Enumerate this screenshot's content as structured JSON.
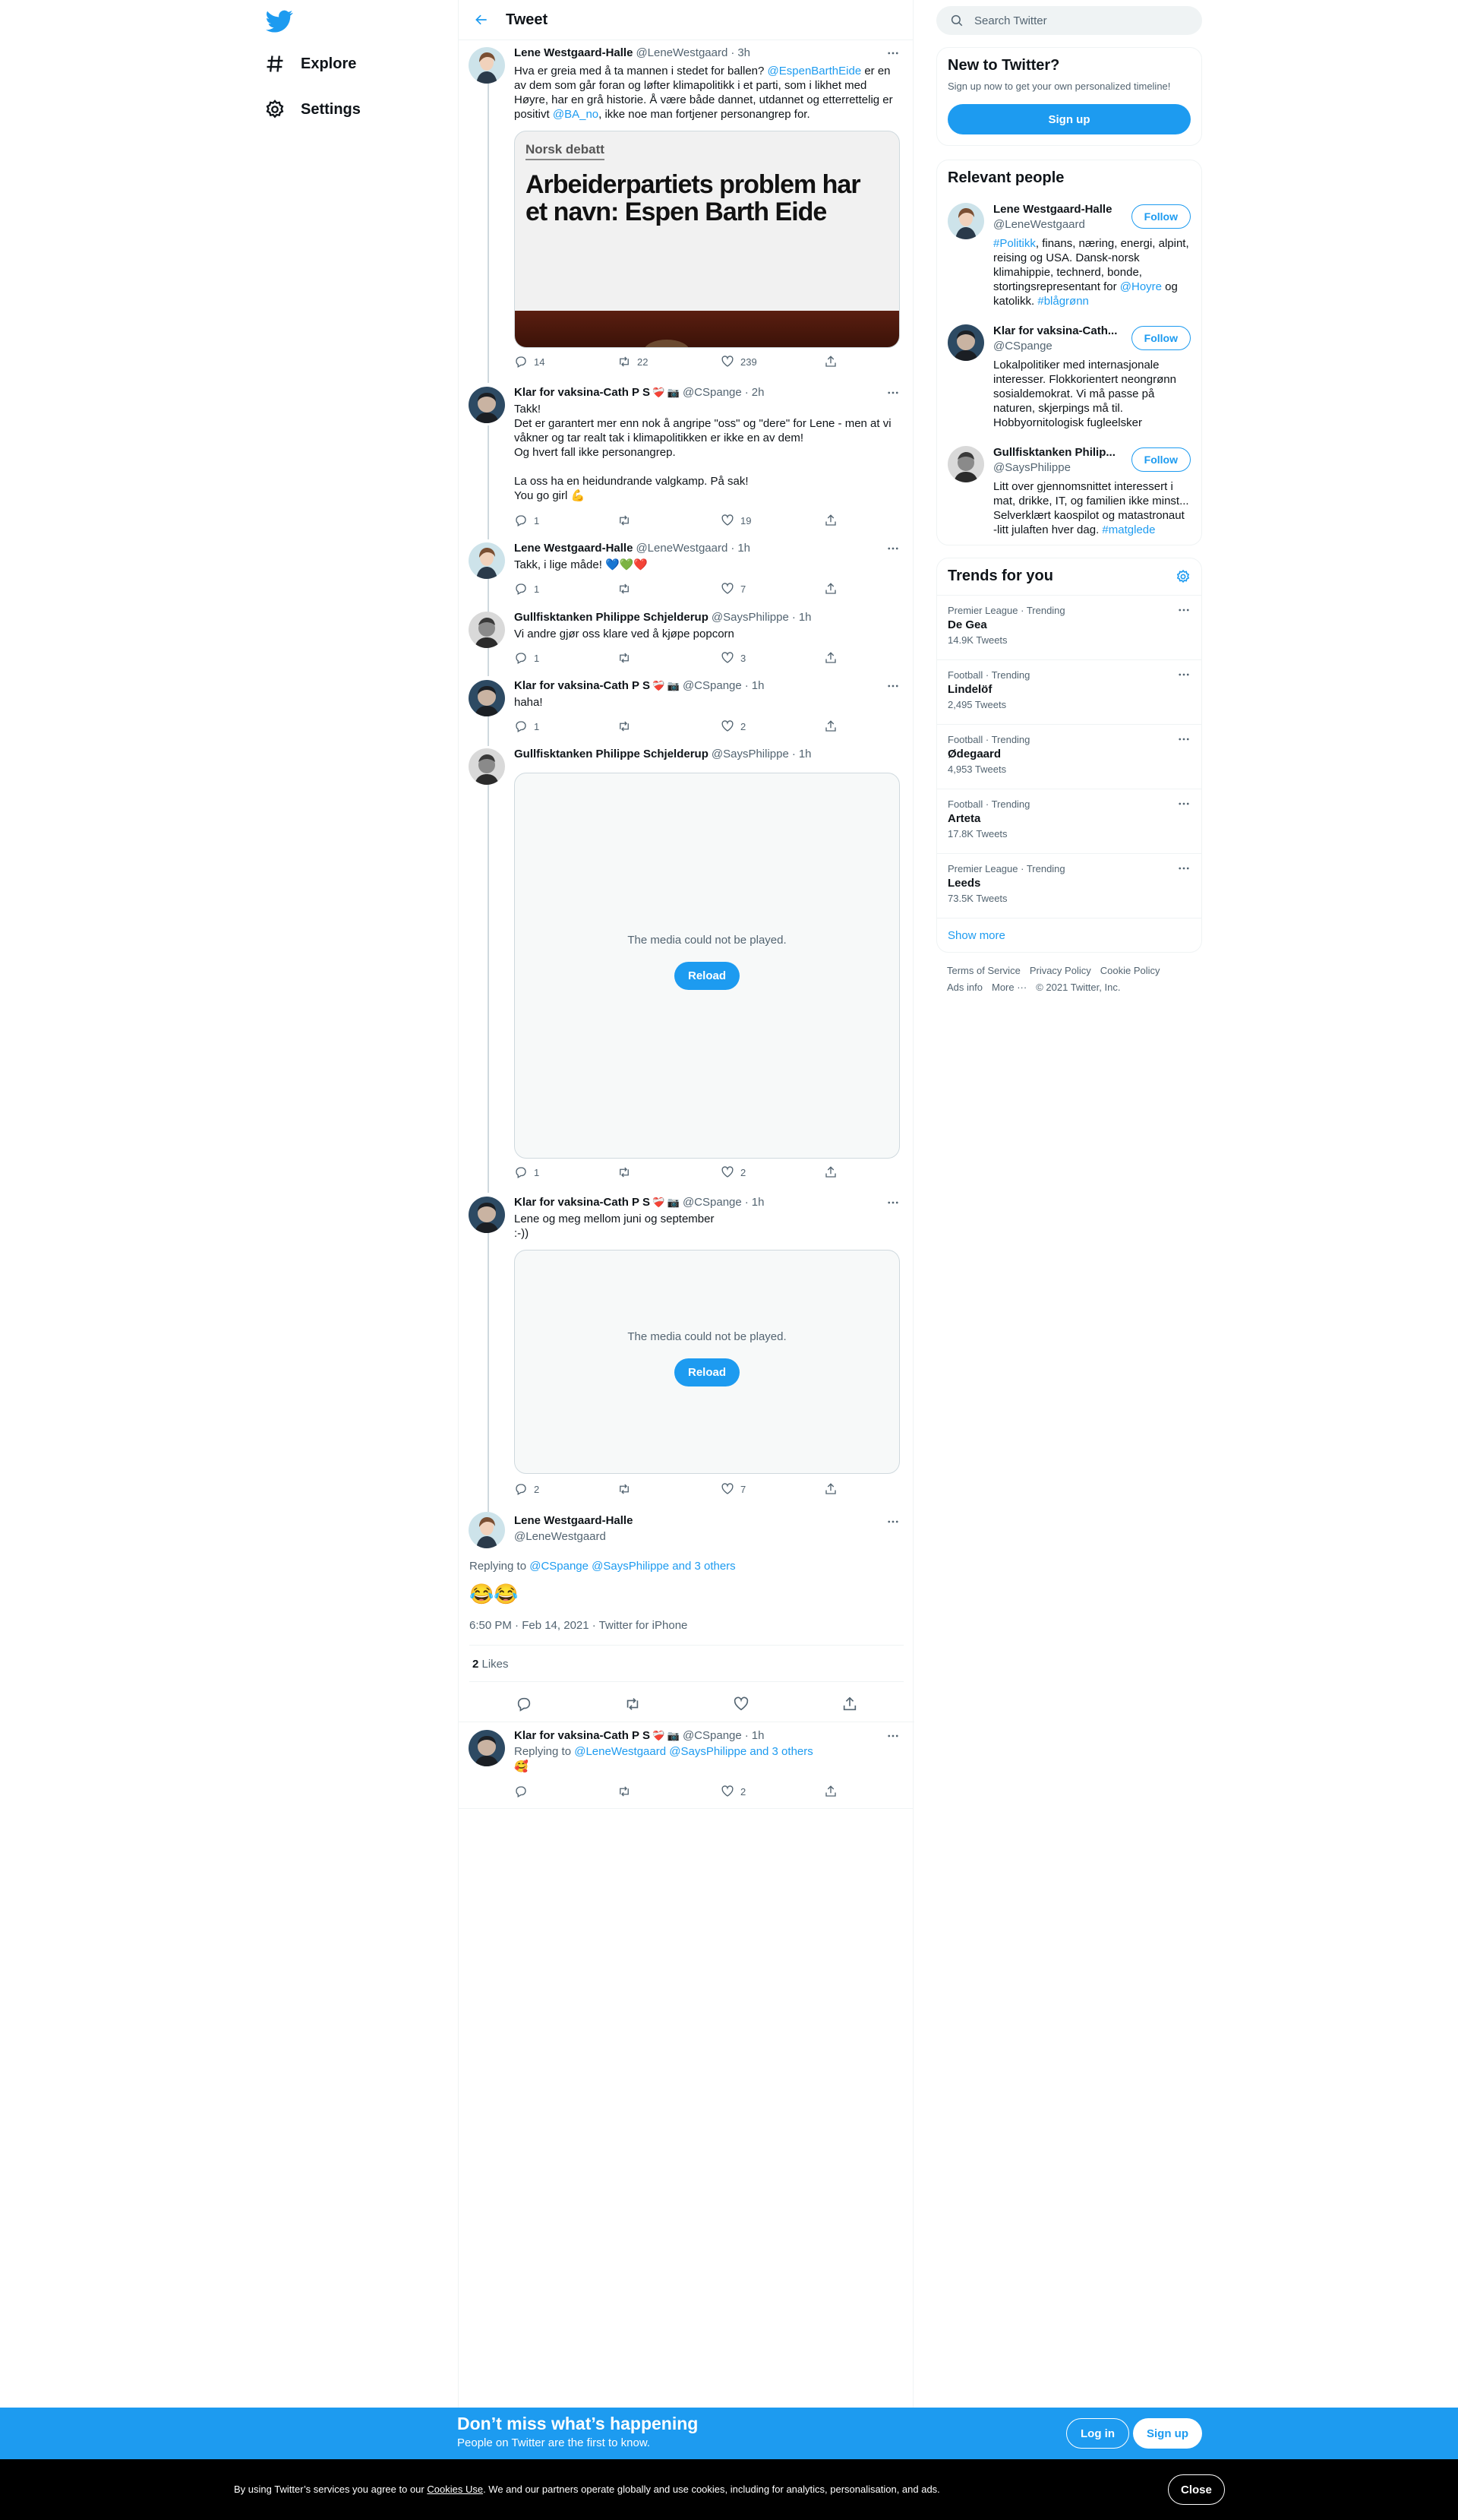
{
  "nav": {
    "explore": "Explore",
    "settings": "Settings"
  },
  "header": {
    "title": "Tweet"
  },
  "tweets": [
    {
      "name": "Lene Westgaard-Halle",
      "handle": "@LeneWestgaard",
      "dot": "·",
      "time": "3h",
      "text_parts": [
        "Hva er greia med å ta mannen i stedet for ballen? ",
        "@EspenBarthEide",
        " er en av dem som går foran og løfter klimapolitikk i et parti, som i likhet med Høyre, har en grå historie. Å være både dannet, utdannet og etterrettelig er positivt ",
        "@BA_no",
        ", ikke noe man fortjener personangrep for."
      ],
      "card": {
        "kicker": "Norsk debatt",
        "headline": "Arbeiderpartiets problem har et navn: Espen Barth Eide"
      },
      "replies": "14",
      "retweets": "22",
      "likes": "239"
    },
    {
      "name": "Klar for vaksina-Cath P S",
      "emoji": "❤️‍🩹 📷",
      "handle": "@CSpange",
      "dot": "·",
      "time": "2h",
      "text": "Takk!\nDet er garantert mer enn nok å angripe \"oss\" og \"dere\" for Lene - men at vi våkner og tar realt tak i klimapolitikken er ikke en av dem!\nOg hvert fall ikke personangrep.\n\nLa oss ha en heidundrande valgkamp. På sak!\nYou go girl 💪",
      "replies": "1",
      "retweets": "",
      "likes": "19"
    },
    {
      "name": "Lene Westgaard-Halle",
      "handle": "@LeneWestgaard",
      "dot": "·",
      "time": "1h",
      "text": "Takk, i lige måde! 💙💚❤️",
      "replies": "1",
      "retweets": "",
      "likes": "7"
    },
    {
      "name": "Gullfisktanken Philippe Schjelderup",
      "handle": "@SaysPhilippe",
      "dot": "·",
      "time": "1h",
      "text": "Vi andre gjør oss klare ved å kjøpe popcorn",
      "replies": "1",
      "retweets": "",
      "likes": "3"
    },
    {
      "name": "Klar for vaksina-Cath P S",
      "emoji": "❤️‍🩹 📷",
      "handle": "@CSpange",
      "dot": "·",
      "time": "1h",
      "text": "haha!",
      "replies": "1",
      "retweets": "",
      "likes": "2"
    },
    {
      "name": "Gullfisktanken Philippe Schjelderup",
      "handle": "@SaysPhilippe",
      "dot": "·",
      "time": "1h",
      "media_msg": "The media could not be played.",
      "reload": "Reload",
      "replies": "1",
      "retweets": "",
      "likes": "2"
    },
    {
      "name": "Klar for vaksina-Cath P S",
      "emoji": "❤️‍🩹 📷",
      "handle": "@CSpange",
      "dot": "·",
      "time": "1h",
      "text": "Lene og meg mellom juni og september\n:-))",
      "media_msg": "The media could not be played.",
      "reload": "Reload",
      "replies": "2",
      "retweets": "",
      "likes": "7"
    }
  ],
  "focused": {
    "name": "Lene Westgaard-Halle",
    "handle": "@LeneWestgaard",
    "replying_prefix": "Replying to ",
    "replying_users": "@CSpange @SaysPhilippe and 3 others",
    "text": "😂😂",
    "meta": "6:50 PM · Feb 14, 2021 · Twitter for iPhone",
    "likes_count": "2",
    "likes_label": " Likes"
  },
  "reply": {
    "name": "Klar for vaksina-Cath P S",
    "emoji": "❤️‍🩹 📷",
    "handle": "@CSpange",
    "dot": "·",
    "time": "1h",
    "replying_prefix": "Replying to ",
    "replying_users": "@LeneWestgaard @SaysPhilippe and 3 others",
    "text": "🥰",
    "replies": "",
    "retweets": "",
    "likes": "2"
  },
  "right": {
    "search_placeholder": "Search Twitter",
    "new": {
      "title": "New to Twitter?",
      "sub": "Sign up now to get your own personalized timeline!",
      "button": "Sign up"
    },
    "relevant": {
      "title": "Relevant people",
      "follow": "Follow",
      "people": [
        {
          "name": "Lene Westgaard-Halle",
          "handle": "@LeneWestgaard",
          "bio_parts": [
            "#Politikk",
            ", finans, næring, energi, alpint, reising og USA. Dansk-norsk klimahippie, technerd, bonde, stortingsrepresentant for ",
            "@Hoyre",
            " og katolikk. ",
            "#blågrønn"
          ]
        },
        {
          "name": "Klar for vaksina-Cath...",
          "handle": "@CSpange",
          "bio": "Lokalpolitiker med internasjonale interesser. Flokkorientert neongrønn sosialdemokrat. Vi må passe på naturen, skjerpings må til. Hobbyornitologisk fugleelsker"
        },
        {
          "name": "Gullfisktanken Philip...",
          "handle": "@SaysPhilippe",
          "bio_parts": [
            "Litt over gjennomsnittet interessert i mat, drikke, IT, og familien ikke minst... Selverklært kaospilot og matastronaut -litt julaften hver dag. ",
            "#matglede"
          ]
        }
      ]
    },
    "trends": {
      "title": "Trends for you",
      "show_more": "Show more",
      "items": [
        {
          "context": "Premier League · Trending",
          "name": "De Gea",
          "count": "14.9K Tweets"
        },
        {
          "context": "Football · Trending",
          "name": "Lindelöf",
          "count": "2,495 Tweets"
        },
        {
          "context": "Football · Trending",
          "name": "Ødegaard",
          "count": "4,953 Tweets"
        },
        {
          "context": "Football · Trending",
          "name": "Arteta",
          "count": "17.8K Tweets"
        },
        {
          "context": "Premier League · Trending",
          "name": "Leeds",
          "count": "73.5K Tweets"
        }
      ]
    },
    "footer": {
      "terms": "Terms of Service",
      "privacy": "Privacy Policy",
      "cookie": "Cookie Policy",
      "ads": "Ads info",
      "more": "More ···",
      "copyright": "© 2021 Twitter, Inc."
    }
  },
  "bottom": {
    "title": "Don’t miss what’s happening",
    "sub": "People on Twitter are the first to know.",
    "login": "Log in",
    "signup": "Sign up"
  },
  "cookie": {
    "prefix": "By using Twitter’s services you agree to our ",
    "link": "Cookies Use",
    "suffix": ". We and our partners operate globally and use cookies, including for analytics, personalisation, and ads.",
    "close": "Close"
  },
  "colors": {
    "accent": "#1d9bf0",
    "text": "#0f1419",
    "secondary": "#536471"
  }
}
